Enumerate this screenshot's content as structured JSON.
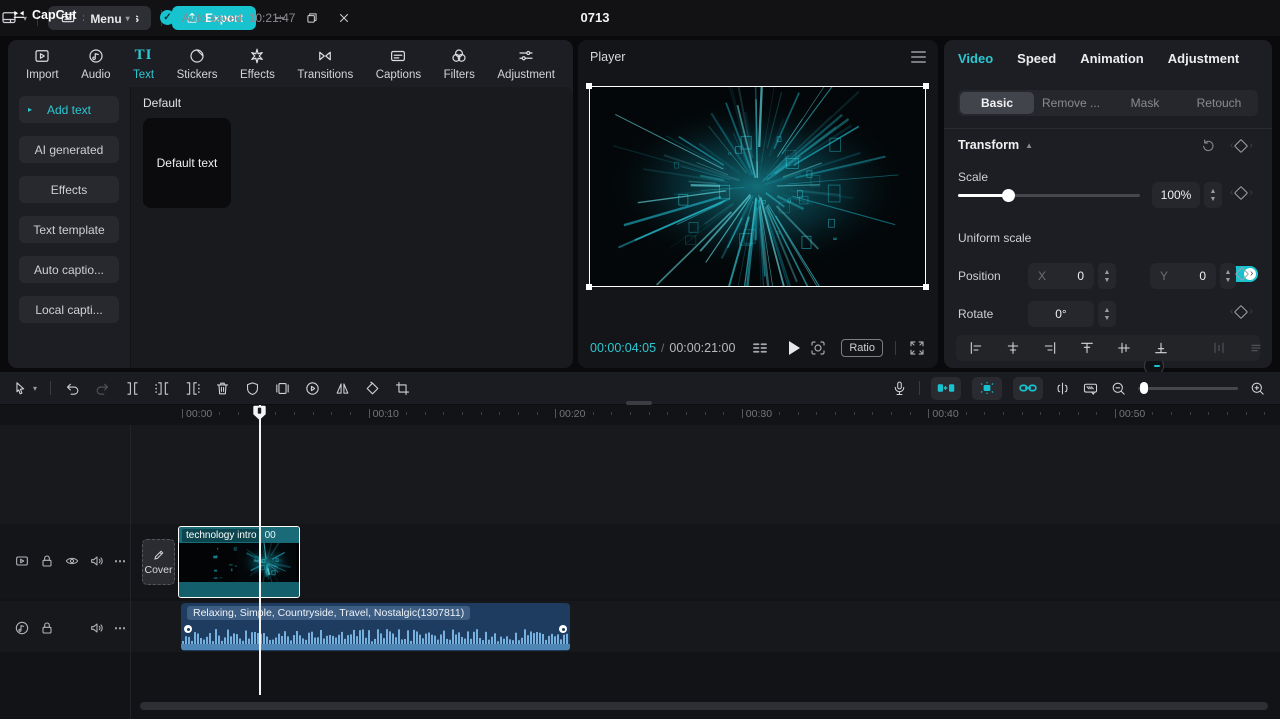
{
  "colors": {
    "accent": "#2cc8d2",
    "export_button": "#17c3ce",
    "panel_background": "#1d1e23",
    "audio_clip": "#1d3c60",
    "waveform": "#7ab6e5",
    "video_clip": "#15646f",
    "selection_border": "#ffffff"
  },
  "titlebar": {
    "logo_text": "CapCut",
    "menu_label": "Menu",
    "autosave_text": "Auto saved: 10:21:47",
    "project_title": "0713",
    "shortcuts_label": "Shortcuts",
    "export_label": "Export"
  },
  "media_tabs": {
    "items": [
      {
        "label": "Import",
        "icon": "import-icon",
        "active": false
      },
      {
        "label": "Audio",
        "icon": "audio-icon",
        "active": false
      },
      {
        "label": "Text",
        "icon": "text-icon",
        "active": true
      },
      {
        "label": "Stickers",
        "icon": "sticker-icon",
        "active": false
      },
      {
        "label": "Effects",
        "icon": "effects-icon",
        "active": false
      },
      {
        "label": "Transitions",
        "icon": "transitions-icon",
        "active": false
      },
      {
        "label": "Captions",
        "icon": "captions-icon",
        "active": false
      },
      {
        "label": "Filters",
        "icon": "filters-icon",
        "active": false
      },
      {
        "label": "Adjustment",
        "icon": "adjustment-icon",
        "active": false
      }
    ]
  },
  "text_panel": {
    "sidebar": [
      {
        "label": "Add text",
        "active": true
      },
      {
        "label": "AI generated",
        "active": false
      },
      {
        "label": "Effects",
        "active": false
      },
      {
        "label": "Text template",
        "active": false
      },
      {
        "label": "Auto captio...",
        "active": false
      },
      {
        "label": "Local capti...",
        "active": false
      }
    ],
    "section_title": "Default",
    "card_label": "Default text"
  },
  "player": {
    "title": "Player",
    "current_time": "00:00:04:05",
    "separator": "/",
    "duration": "00:00:21:00",
    "ratio_label": "Ratio"
  },
  "inspector": {
    "tabs": [
      {
        "label": "Video",
        "active": true
      },
      {
        "label": "Speed",
        "active": false
      },
      {
        "label": "Animation",
        "active": false
      },
      {
        "label": "Adjustment",
        "active": false
      }
    ],
    "subtabs": [
      {
        "label": "Basic",
        "active": true
      },
      {
        "label": "Remove ...",
        "active": false
      },
      {
        "label": "Mask",
        "active": false
      },
      {
        "label": "Retouch",
        "active": false
      }
    ],
    "transform": {
      "title": "Transform",
      "scale_label": "Scale",
      "scale_value": "100%",
      "uniform_scale_label": "Uniform scale",
      "uniform_scale_on": true,
      "position_label": "Position",
      "x_label": "X",
      "x_value": "0",
      "y_label": "Y",
      "y_value": "0",
      "rotate_label": "Rotate",
      "rotate_value": "0°"
    }
  },
  "timeline": {
    "ruler_labels": [
      "00:00",
      "00:10",
      "00:20",
      "00:30",
      "00:40",
      "00:50"
    ],
    "cover_label": "Cover",
    "video_clip": {
      "label": "technology intro",
      "suffix": "00"
    },
    "audio_clip": {
      "label": "Relaxing, Simple, Countryside, Travel, Nostalgic(1307811)"
    }
  }
}
